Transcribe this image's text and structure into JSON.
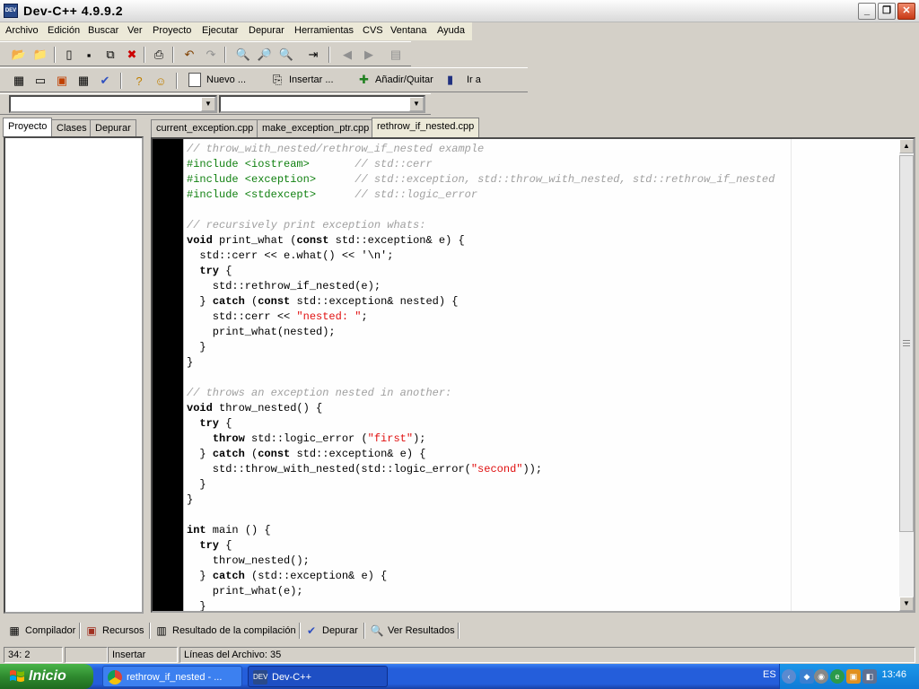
{
  "window": {
    "title": "Dev-C++ 4.9.9.2",
    "icon_text": "DEV"
  },
  "menubar": [
    "Archivo",
    "Edición",
    "Buscar",
    "Ver",
    "Proyecto",
    "Ejecutar",
    "Depurar",
    "Herramientas",
    "CVS",
    "Ventana",
    "Ayuda"
  ],
  "toolbar2": {
    "nuevo": "Nuevo ...",
    "insertar": "Insertar ...",
    "anadir": "Añadir/Quitar",
    "ira": "Ir a"
  },
  "left_tabs": [
    "Proyecto",
    "Clases",
    "Depurar"
  ],
  "file_tabs": [
    "current_exception.cpp",
    "make_exception_ptr.cpp",
    "rethrow_if_nested.cpp"
  ],
  "code": [
    [
      [
        "cm",
        "// throw_with_nested/rethrow_if_nested example"
      ]
    ],
    [
      [
        "pp",
        "#include <iostream>"
      ],
      [
        "",
        "       "
      ],
      [
        "cm",
        "// std::cerr"
      ]
    ],
    [
      [
        "pp",
        "#include <exception>"
      ],
      [
        "",
        "      "
      ],
      [
        "cm",
        "// std::exception, std::throw_with_nested, std::rethrow_if_nested"
      ]
    ],
    [
      [
        "pp",
        "#include <stdexcept>"
      ],
      [
        "",
        "      "
      ],
      [
        "cm",
        "// std::logic_error"
      ]
    ],
    [],
    [
      [
        "cm",
        "// recursively print exception whats:"
      ]
    ],
    [
      [
        "kw",
        "void"
      ],
      [
        "",
        " print_what ("
      ],
      [
        "kw",
        "const"
      ],
      [
        "",
        " std::exception& e) {"
      ]
    ],
    [
      [
        "",
        "  std::cerr << e.what() << '\\n';"
      ]
    ],
    [
      [
        "",
        "  "
      ],
      [
        "kw",
        "try"
      ],
      [
        "",
        " {"
      ]
    ],
    [
      [
        "",
        "    std::rethrow_if_nested(e);"
      ]
    ],
    [
      [
        "",
        "  } "
      ],
      [
        "kw",
        "catch"
      ],
      [
        "",
        " ("
      ],
      [
        "kw",
        "const"
      ],
      [
        "",
        " std::exception& nested) {"
      ]
    ],
    [
      [
        "",
        "    std::cerr << "
      ],
      [
        "st",
        "\"nested: \""
      ],
      [
        "",
        ";"
      ]
    ],
    [
      [
        "",
        "    print_what(nested);"
      ]
    ],
    [
      [
        "",
        "  }"
      ]
    ],
    [
      [
        "",
        "}"
      ]
    ],
    [],
    [
      [
        "cm",
        "// throws an exception nested in another:"
      ]
    ],
    [
      [
        "kw",
        "void"
      ],
      [
        "",
        " throw_nested() {"
      ]
    ],
    [
      [
        "",
        "  "
      ],
      [
        "kw",
        "try"
      ],
      [
        "",
        " {"
      ]
    ],
    [
      [
        "",
        "    "
      ],
      [
        "kw",
        "throw"
      ],
      [
        "",
        " std::logic_error ("
      ],
      [
        "st",
        "\"first\""
      ],
      [
        "",
        ");"
      ]
    ],
    [
      [
        "",
        "  } "
      ],
      [
        "kw",
        "catch"
      ],
      [
        "",
        " ("
      ],
      [
        "kw",
        "const"
      ],
      [
        "",
        " std::exception& e) {"
      ]
    ],
    [
      [
        "",
        "    std::throw_with_nested(std::logic_error("
      ],
      [
        "st",
        "\"second\""
      ],
      [
        "",
        "));"
      ]
    ],
    [
      [
        "",
        "  }"
      ]
    ],
    [
      [
        "",
        "}"
      ]
    ],
    [],
    [
      [
        "kw",
        "int"
      ],
      [
        "",
        " main () {"
      ]
    ],
    [
      [
        "",
        "  "
      ],
      [
        "kw",
        "try"
      ],
      [
        "",
        " {"
      ]
    ],
    [
      [
        "",
        "    throw_nested();"
      ]
    ],
    [
      [
        "",
        "  } "
      ],
      [
        "kw",
        "catch"
      ],
      [
        "",
        " (std::exception& e) {"
      ]
    ],
    [
      [
        "",
        "    print_what(e);"
      ]
    ],
    [
      [
        "",
        "  }"
      ]
    ]
  ],
  "bottom_tabs": [
    "Compilador",
    "Recursos",
    "Resultado de la compilación",
    "Depurar",
    "Ver Resultados"
  ],
  "status": {
    "position": "34: 2",
    "mode": "Insertar",
    "lines": "Líneas del Archivo: 35"
  },
  "taskbar": {
    "start": "Inicio",
    "tasks": [
      "rethrow_if_nested - ...",
      "Dev-C++"
    ],
    "lang": "ES",
    "clock": "13:46"
  }
}
